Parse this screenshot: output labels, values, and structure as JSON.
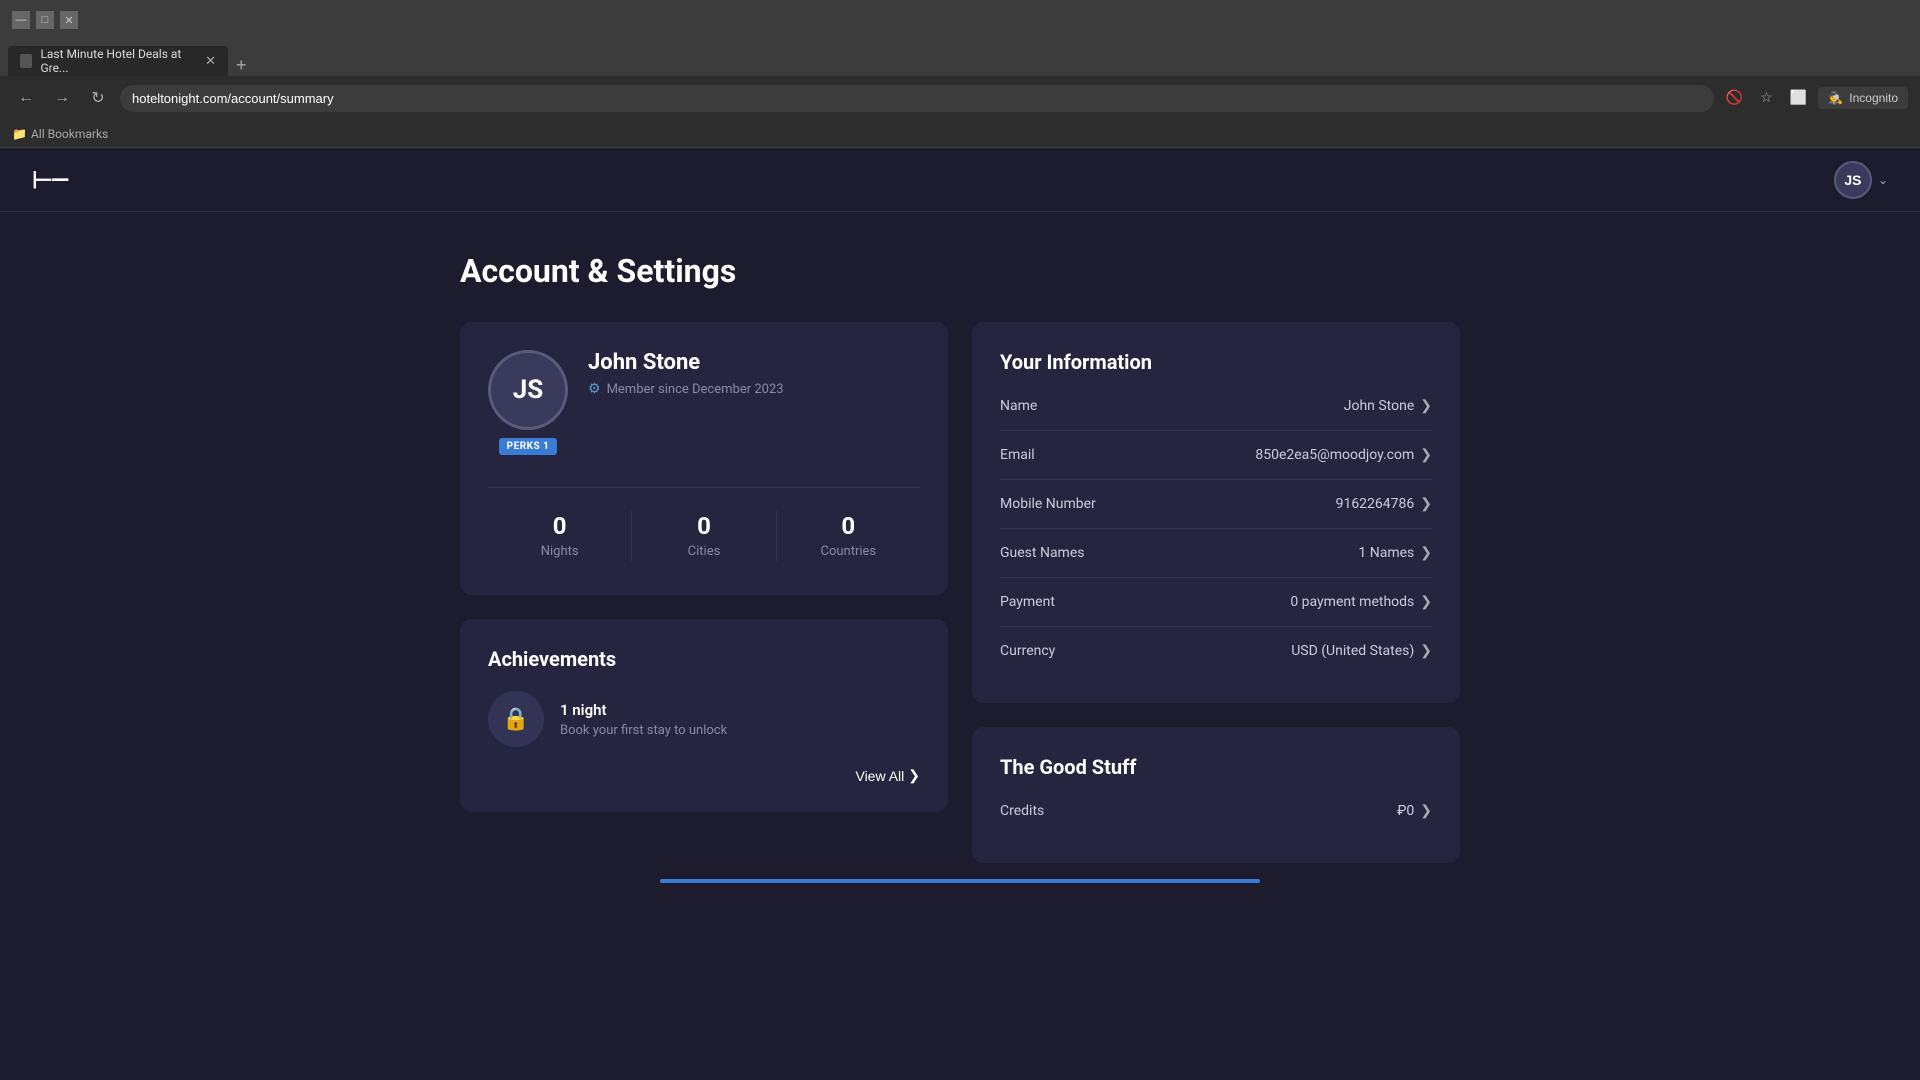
{
  "browser": {
    "tab_title": "Last Minute Hotel Deals at Gre...",
    "url": "hoteltonight.com/account/summary",
    "incognito_label": "Incognito",
    "bookmarks_label": "All Bookmarks",
    "new_tab_label": "+"
  },
  "header": {
    "logo_text": "⊢—",
    "user_initials": "JS",
    "chevron": "❯"
  },
  "page": {
    "title": "Account & Settings"
  },
  "profile": {
    "avatar_initials": "JS",
    "name": "John Stone",
    "perks_label": "PERKS 1",
    "member_since": "Member since December 2023",
    "stats": [
      {
        "number": "0",
        "label": "Nights"
      },
      {
        "number": "0",
        "label": "Cities"
      },
      {
        "number": "0",
        "label": "Countries"
      }
    ]
  },
  "achievements": {
    "title": "Achievements",
    "item_name": "1 night",
    "item_desc": "Book your first stay to unlock",
    "view_all_label": "View All",
    "lock_icon": "🔒"
  },
  "your_information": {
    "title": "Your Information",
    "rows": [
      {
        "label": "Name",
        "value": "John Stone"
      },
      {
        "label": "Email",
        "value": "850e2ea5@moodjoy.com"
      },
      {
        "label": "Mobile Number",
        "value": "9162264786"
      },
      {
        "label": "Guest Names",
        "value": "1 Names"
      },
      {
        "label": "Payment",
        "value": "0 payment methods"
      },
      {
        "label": "Currency",
        "value": "USD (United States)"
      }
    ],
    "chevron": "❯"
  },
  "good_stuff": {
    "title": "The Good Stuff",
    "rows": [
      {
        "label": "Credits",
        "value": "₽0"
      }
    ],
    "chevron": "❯"
  },
  "icons": {
    "verified": "⚙",
    "lock": "🔒",
    "chevron_right": "❯",
    "chevron_down": "❯"
  }
}
